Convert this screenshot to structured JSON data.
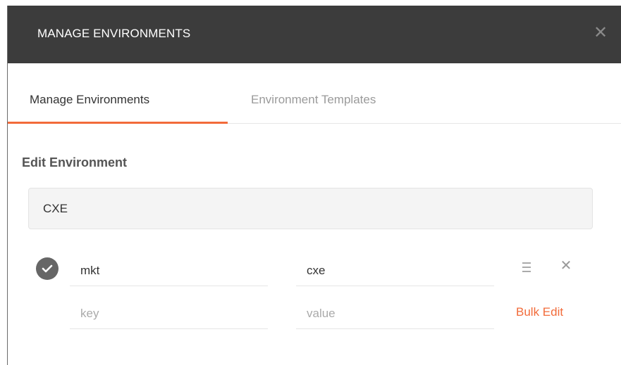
{
  "header": {
    "title": "MANAGE ENVIRONMENTS",
    "close_icon": "close-icon"
  },
  "tabs": [
    {
      "label": "Manage Environments",
      "active": true
    },
    {
      "label": "Environment Templates",
      "active": false
    }
  ],
  "editor": {
    "section_title": "Edit Environment",
    "environment_name": "CXE",
    "variables": [
      {
        "enabled": true,
        "key": "mkt",
        "value": "cxe"
      }
    ],
    "new_row": {
      "key_placeholder": "key",
      "value_placeholder": "value"
    },
    "bulk_edit_label": "Bulk Edit"
  },
  "colors": {
    "titlebar": "#3c3c3c",
    "accent": "#f26b3a",
    "checkbox": "#666666"
  }
}
